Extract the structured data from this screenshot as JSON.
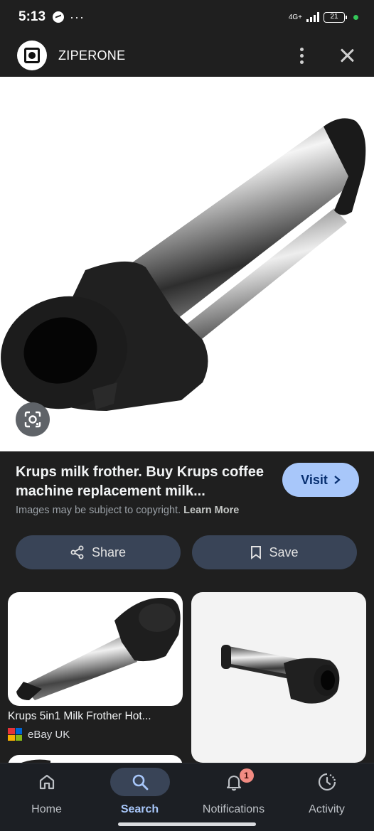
{
  "status_bar": {
    "time": "5:13",
    "more": "···",
    "network": "4G+",
    "battery": "21"
  },
  "header": {
    "site_name": "ZIPERONE"
  },
  "result": {
    "title": "Krups milk frother. Buy Krups coffee machine replacement milk...",
    "visit_label": "Visit",
    "copyright_text": "Images may be subject to copyright.",
    "learn_more_label": "Learn More",
    "share_label": "Share",
    "save_label": "Save"
  },
  "related": [
    {
      "title": "Krups 5in1 Milk Frother Hot...",
      "source": "eBay UK",
      "source_icon": "ebay-icon"
    }
  ],
  "nav": {
    "items": [
      {
        "label": "Home",
        "icon": "home-icon"
      },
      {
        "label": "Search",
        "icon": "search-icon",
        "selected": true
      },
      {
        "label": "Notifications",
        "icon": "bell-icon",
        "badge": "1"
      },
      {
        "label": "Activity",
        "icon": "activity-icon"
      }
    ]
  },
  "colors": {
    "accent": "#a8c7fa",
    "background": "#1f1f1f",
    "button": "#394457",
    "badge": "#f28b82"
  }
}
